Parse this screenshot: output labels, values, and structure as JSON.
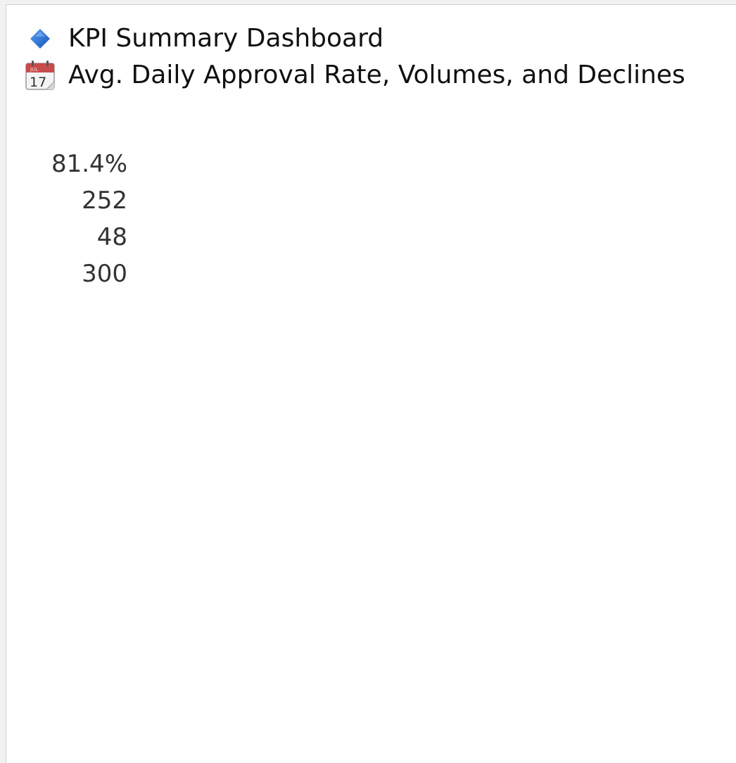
{
  "header": {
    "title": "KPI Summary Dashboard",
    "title_icon": "blue-diamond-icon",
    "subtitle": "Avg. Daily Approval Rate, Volumes, and Declines",
    "subtitle_icon": "calendar-icon",
    "calendar_icon_month": "JUL",
    "calendar_icon_day": "17"
  },
  "kpis": {
    "values": [
      "81.4%",
      "252",
      "48",
      "300"
    ]
  },
  "colors": {
    "diamond": "#1e6fd9",
    "calendar_header": "#c94b4b",
    "value_text": "#333333"
  }
}
